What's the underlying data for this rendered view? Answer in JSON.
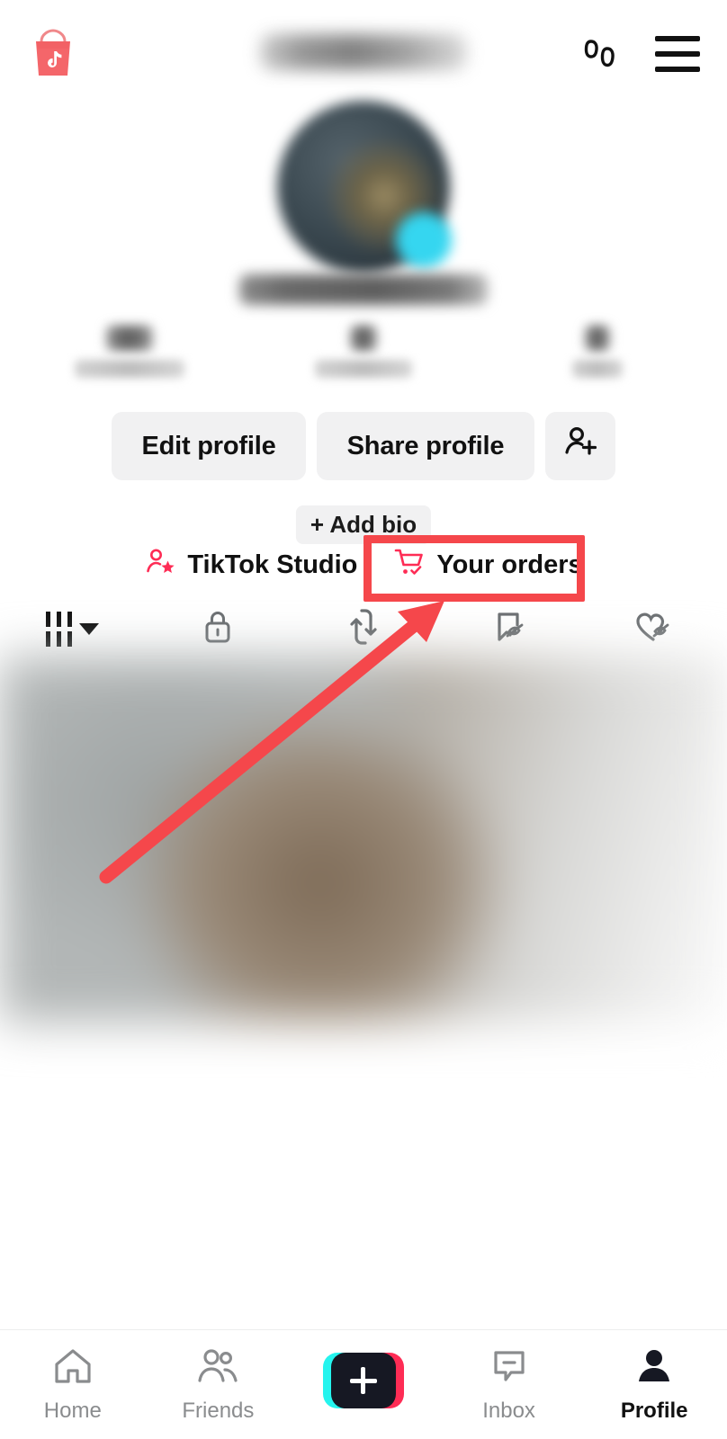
{
  "app": {
    "name": "TikTok",
    "screen": "Profile",
    "accent_pink": "#fe2c55",
    "accent_cyan": "#25f4ee",
    "annotation_red": "#f5474b",
    "chip_bg": "#f1f1f2"
  },
  "header": {
    "shop_icon": "tiktok-shop-bag-icon",
    "username_redacted": "",
    "footprints_icon": "footprints-icon",
    "menu_icon": "hamburger-menu-icon"
  },
  "profile": {
    "avatar_icon": "avatar-image",
    "avatar_badge_icon": "add-photo-badge-icon",
    "handle_redacted": "",
    "stats": [
      {
        "value": "",
        "label": "",
        "name": "following"
      },
      {
        "value": "",
        "label": "",
        "name": "followers"
      },
      {
        "value": "",
        "label": "",
        "name": "likes"
      }
    ],
    "buttons": {
      "edit_profile": "Edit profile",
      "share_profile": "Share profile",
      "add_friends_icon": "add-user-icon"
    },
    "add_bio": "+ Add bio"
  },
  "shortcuts": [
    {
      "label": "TikTok Studio",
      "icon": "person-star-icon"
    },
    {
      "label": "Your orders",
      "icon": "shopping-cart-check-icon"
    }
  ],
  "content_tabs": [
    {
      "name": "posts",
      "icon": "grid-dropdown-icon",
      "active": true
    },
    {
      "name": "private",
      "icon": "lock-icon",
      "active": false
    },
    {
      "name": "reposts",
      "icon": "repost-arrows-icon",
      "active": false
    },
    {
      "name": "saved",
      "icon": "bookmark-hidden-icon",
      "active": false
    },
    {
      "name": "liked",
      "icon": "heart-hidden-icon",
      "active": false
    }
  ],
  "content": {
    "thumbnail_redacted": ""
  },
  "bottom_nav": [
    {
      "label": "Home",
      "icon": "home-icon",
      "active": false
    },
    {
      "label": "Friends",
      "icon": "friends-icon",
      "active": false
    },
    {
      "label": "",
      "icon": "create-plus-icon",
      "active": false
    },
    {
      "label": "Inbox",
      "icon": "inbox-icon",
      "active": false
    },
    {
      "label": "Profile",
      "icon": "profile-person-icon",
      "active": true
    }
  ],
  "annotations": [
    {
      "name": "your-orders-highlight",
      "shape": "rectangle",
      "color": "#f5474b"
    },
    {
      "name": "profile-tab-highlight",
      "shape": "rectangle",
      "color": "#f5474b"
    },
    {
      "name": "pointer-arrow",
      "shape": "arrow",
      "color": "#f5474b"
    }
  ]
}
